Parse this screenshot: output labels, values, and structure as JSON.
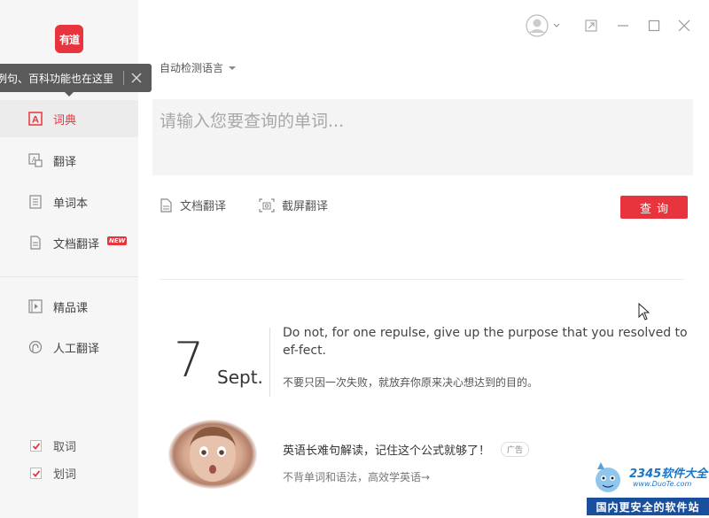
{
  "app": {
    "logo_text": "有道",
    "brand_color": "#e8343d"
  },
  "tooltip": {
    "text": "例句、百科功能也在这里"
  },
  "sidebar": {
    "items": [
      {
        "label": "词典",
        "icon": "dictionary-icon",
        "active": true
      },
      {
        "label": "翻译",
        "icon": "translate-icon"
      },
      {
        "label": "单词本",
        "icon": "wordbook-icon"
      },
      {
        "label": "文档翻译",
        "icon": "document-translate-icon",
        "badge": "NEW"
      },
      {
        "label": "精品课",
        "icon": "course-icon"
      },
      {
        "label": "人工翻译",
        "icon": "human-translate-icon"
      }
    ],
    "options": [
      {
        "label": "取词",
        "checked": true
      },
      {
        "label": "划词",
        "checked": true
      }
    ]
  },
  "main": {
    "language_select": "自动检测语言",
    "query_placeholder": "请输入您要查询的单词...",
    "doc_translate": "文档翻译",
    "screenshot_translate": "截屏翻译",
    "search_button": "查询"
  },
  "daily": {
    "day": "7",
    "month": "Sept.",
    "english": "Do not, for one repulse, give up the purpose that you resolved to ef-fect.",
    "chinese": "不要只因一次失败，就放弃你原来决心想达到的目的。"
  },
  "ad": {
    "title": "英语长难句解读，记住这个公式就够了！",
    "badge": "广告",
    "subtitle": "不背单词和语法，高效学英语→"
  },
  "watermark": {
    "logo": "2345软件大全",
    "url": "www.DuoTe.com",
    "slogan": "国内更安全的软件站"
  }
}
